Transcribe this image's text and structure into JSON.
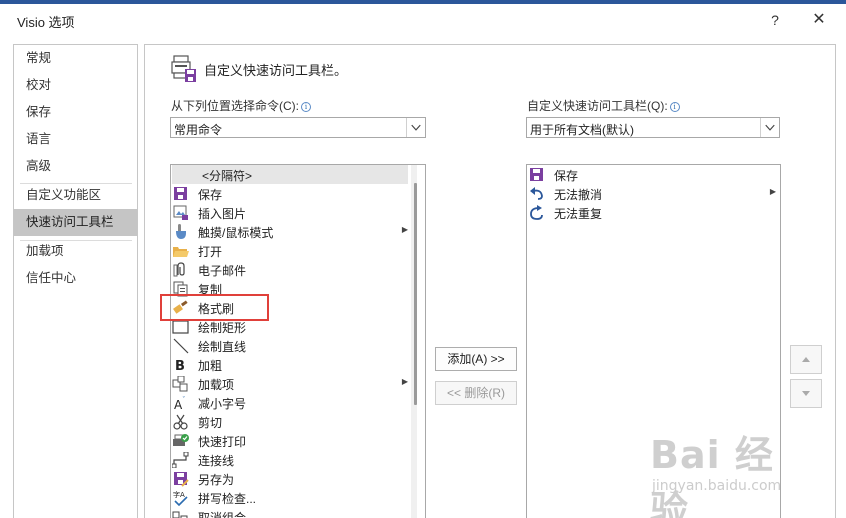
{
  "window": {
    "title": "Visio 选项",
    "help": "?",
    "close": "✕",
    "accent": "#2b579a"
  },
  "nav": {
    "items": [
      {
        "label": "常规",
        "active": false
      },
      {
        "label": "校对",
        "active": false
      },
      {
        "label": "保存",
        "active": false
      },
      {
        "label": "语言",
        "active": false
      },
      {
        "label": "高级",
        "active": false
      },
      {
        "label": "自定义功能区",
        "active": false
      },
      {
        "label": "快速访问工具栏",
        "active": true
      },
      {
        "label": "加载项",
        "active": false
      },
      {
        "label": "信任中心",
        "active": false
      }
    ]
  },
  "main": {
    "heading": "自定义快速访问工具栏。",
    "left_label": "从下列位置选择命令(C):",
    "left_select_value": "常用命令",
    "right_label": "自定义快速访问工具栏(Q):",
    "right_select_value": "用于所有文档(默认)",
    "commands": [
      {
        "label": "<分隔符>",
        "icon": "separator",
        "submenu": false
      },
      {
        "label": "保存",
        "icon": "save-icon",
        "submenu": false
      },
      {
        "label": "插入图片",
        "icon": "insert-picture-icon",
        "submenu": false
      },
      {
        "label": "触摸/鼠标模式",
        "icon": "touch-mouse-icon",
        "submenu": true
      },
      {
        "label": "打开",
        "icon": "open-folder-icon",
        "submenu": false
      },
      {
        "label": "电子邮件",
        "icon": "email-attachment-icon",
        "submenu": false
      },
      {
        "label": "复制",
        "icon": "copy-icon",
        "submenu": false
      },
      {
        "label": "格式刷",
        "icon": "format-painter-icon",
        "submenu": false
      },
      {
        "label": "绘制矩形",
        "icon": "rectangle-icon",
        "submenu": false
      },
      {
        "label": "绘制直线",
        "icon": "line-icon",
        "submenu": false
      },
      {
        "label": "加粗",
        "icon": "bold-icon",
        "submenu": false
      },
      {
        "label": "加载项",
        "icon": "addins-icon",
        "submenu": true
      },
      {
        "label": "减小字号",
        "icon": "decrease-font-icon",
        "submenu": false
      },
      {
        "label": "剪切",
        "icon": "cut-icon",
        "submenu": false
      },
      {
        "label": "快速打印",
        "icon": "quick-print-icon",
        "submenu": false
      },
      {
        "label": "连接线",
        "icon": "connector-icon",
        "submenu": false
      },
      {
        "label": "另存为",
        "icon": "save-as-icon",
        "submenu": false
      },
      {
        "label": "拼写检查...",
        "icon": "spelling-icon",
        "submenu": false
      },
      {
        "label": "取消组合",
        "icon": "ungroup-icon",
        "submenu": false
      }
    ],
    "toolbar_items": [
      {
        "label": "保存",
        "icon": "save-icon",
        "submenu": false
      },
      {
        "label": "无法撤消",
        "icon": "undo-icon",
        "submenu": true
      },
      {
        "label": "无法重复",
        "icon": "redo-icon",
        "submenu": false
      }
    ],
    "add_button": "添加(A) >>",
    "remove_button": "<< 删除(R)",
    "move_up": "▲",
    "move_down": "▼"
  },
  "watermark": {
    "brand": "Bai 经验",
    "url": "jingyan.baidu.com"
  },
  "highlight_color": "#e0403a"
}
